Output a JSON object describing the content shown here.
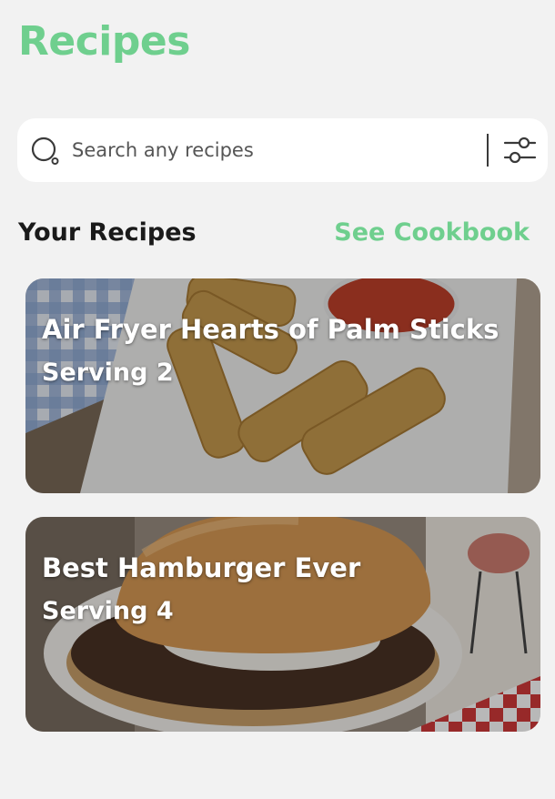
{
  "header": {
    "title": "Recipes"
  },
  "search": {
    "placeholder": "Search any recipes",
    "value": ""
  },
  "section": {
    "title": "Your Recipes",
    "link_label": "See Cookbook"
  },
  "recipes": [
    {
      "title": "Air Fryer Hearts of Palm Sticks",
      "serving": "Serving 2",
      "image": "fried-sticks-with-marinara"
    },
    {
      "title": "Best Hamburger Ever",
      "serving": "Serving 4",
      "image": "hamburger-on-plate"
    }
  ],
  "icons": {
    "search": "search-icon",
    "filter": "filter-sliders-icon"
  },
  "colors": {
    "accent": "#6fcf8e",
    "background": "#f2f2f2",
    "surface": "#ffffff",
    "text": "#1a1a1a"
  }
}
